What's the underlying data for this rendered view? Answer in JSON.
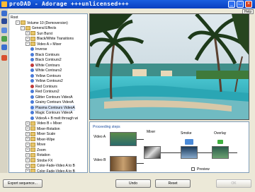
{
  "window": {
    "title": "proDAD - Adorage  +++unlicensed+++",
    "help_label": "Help"
  },
  "tree": {
    "rows": [
      {
        "label": "Root",
        "level": 0,
        "type": "plain"
      },
      {
        "label": "Volume 10 (Demoversion)",
        "level": 1,
        "type": "folder",
        "exp": "−"
      },
      {
        "label": "General Effects",
        "level": 2,
        "type": "folder",
        "exp": "−"
      },
      {
        "label": "Sun Burst",
        "level": 3,
        "type": "folder",
        "exp": "+"
      },
      {
        "label": "Black/White Transitions",
        "level": 3,
        "type": "folder",
        "exp": "+"
      },
      {
        "label": "Video A » Mixer",
        "level": 3,
        "type": "folder",
        "exp": "−"
      },
      {
        "label": "Inverse",
        "level": 4,
        "type": "blue"
      },
      {
        "label": "Black Contours",
        "level": 4,
        "type": "blue"
      },
      {
        "label": "Black Contours2",
        "level": 4,
        "type": "blue"
      },
      {
        "label": "White Contours",
        "level": 4,
        "type": "red"
      },
      {
        "label": "White Contours2",
        "level": 4,
        "type": "blue"
      },
      {
        "label": "Yellow Contours",
        "level": 4,
        "type": "blue"
      },
      {
        "label": "Yellow Contours2",
        "level": 4,
        "type": "blue"
      },
      {
        "label": "Red Contours",
        "level": 4,
        "type": "red"
      },
      {
        "label": "Red Contours2",
        "level": 4,
        "type": "blue"
      },
      {
        "label": "Glitter Contours VideoA",
        "level": 4,
        "type": "blue"
      },
      {
        "label": "Grainy Contours VideoA",
        "level": 4,
        "type": "blue"
      },
      {
        "label": "Plasma Contours VideoA",
        "level": 4,
        "type": "blue",
        "selected": true
      },
      {
        "label": "Magic Contours VideoA",
        "level": 4,
        "type": "blue"
      },
      {
        "label": "VideoA + B melt through wi",
        "level": 4,
        "type": "blue"
      },
      {
        "label": "Video B » Mixer",
        "level": 3,
        "type": "folder",
        "exp": "+"
      },
      {
        "label": "Mixer-Rotation",
        "level": 3,
        "type": "folder",
        "exp": "+"
      },
      {
        "label": "Mixer Scale",
        "level": 3,
        "type": "folder",
        "exp": "+"
      },
      {
        "label": "Mixer-Wipe",
        "level": 3,
        "type": "folder",
        "exp": "+"
      },
      {
        "label": "Move",
        "level": 3,
        "type": "folder",
        "exp": "+"
      },
      {
        "label": "Zoom",
        "level": 3,
        "type": "folder",
        "exp": "+"
      },
      {
        "label": "Rotation",
        "level": 3,
        "type": "folder",
        "exp": "+"
      },
      {
        "label": "Strobe FX",
        "level": 3,
        "type": "folder",
        "exp": "+"
      },
      {
        "label": "Color-Fade-Video A to B",
        "level": 3,
        "type": "folder",
        "exp": "+"
      },
      {
        "label": "Color-Fade-Video A to B",
        "level": 3,
        "type": "folder",
        "exp": "+"
      }
    ]
  },
  "proc": {
    "title": "Proceeding steps",
    "video_a": "Video A",
    "video_b": "Video B",
    "mixer": "Mixer",
    "smoke": "Smoke",
    "overlay": "Overlay",
    "preview": "Preview"
  },
  "buttons": {
    "export": "Export sequence...",
    "undo": "Undo",
    "reset": "Reset",
    "ok": "OK"
  }
}
